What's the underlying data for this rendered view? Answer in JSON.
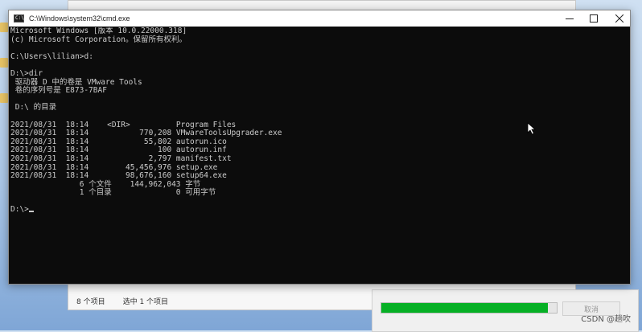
{
  "explorer": {
    "status_items": "8 个项目",
    "status_selected": "选中 1 个项目"
  },
  "copy_dialog": {
    "progress": 0.95,
    "cancel_label": "取消"
  },
  "watermark": "CSDN @趟吹",
  "cmd": {
    "title": "C:\\Windows\\system32\\cmd.exe",
    "lines": [
      "Microsoft Windows [版本 10.0.22000.318]",
      "(c) Microsoft Corporation。保留所有权利。",
      "",
      "C:\\Users\\lilian>d:",
      "",
      "D:\\>dir",
      " 驱动器 D 中的卷是 VMware Tools",
      " 卷的序列号是 E873-7BAF",
      "",
      " D:\\ 的目录",
      "",
      "2021/08/31  18:14    <DIR>          Program Files",
      "2021/08/31  18:14           770,208 VMwareToolsUpgrader.exe",
      "2021/08/31  18:14            55,802 autorun.ico",
      "2021/08/31  18:14               100 autorun.inf",
      "2021/08/31  18:14             2,797 manifest.txt",
      "2021/08/31  18:14        45,456,976 setup.exe",
      "2021/08/31  18:14        98,676,160 setup64.exe",
      "               6 个文件    144,962,043 字节",
      "               1 个目录              0 可用字节",
      "",
      "D:\\>"
    ]
  }
}
